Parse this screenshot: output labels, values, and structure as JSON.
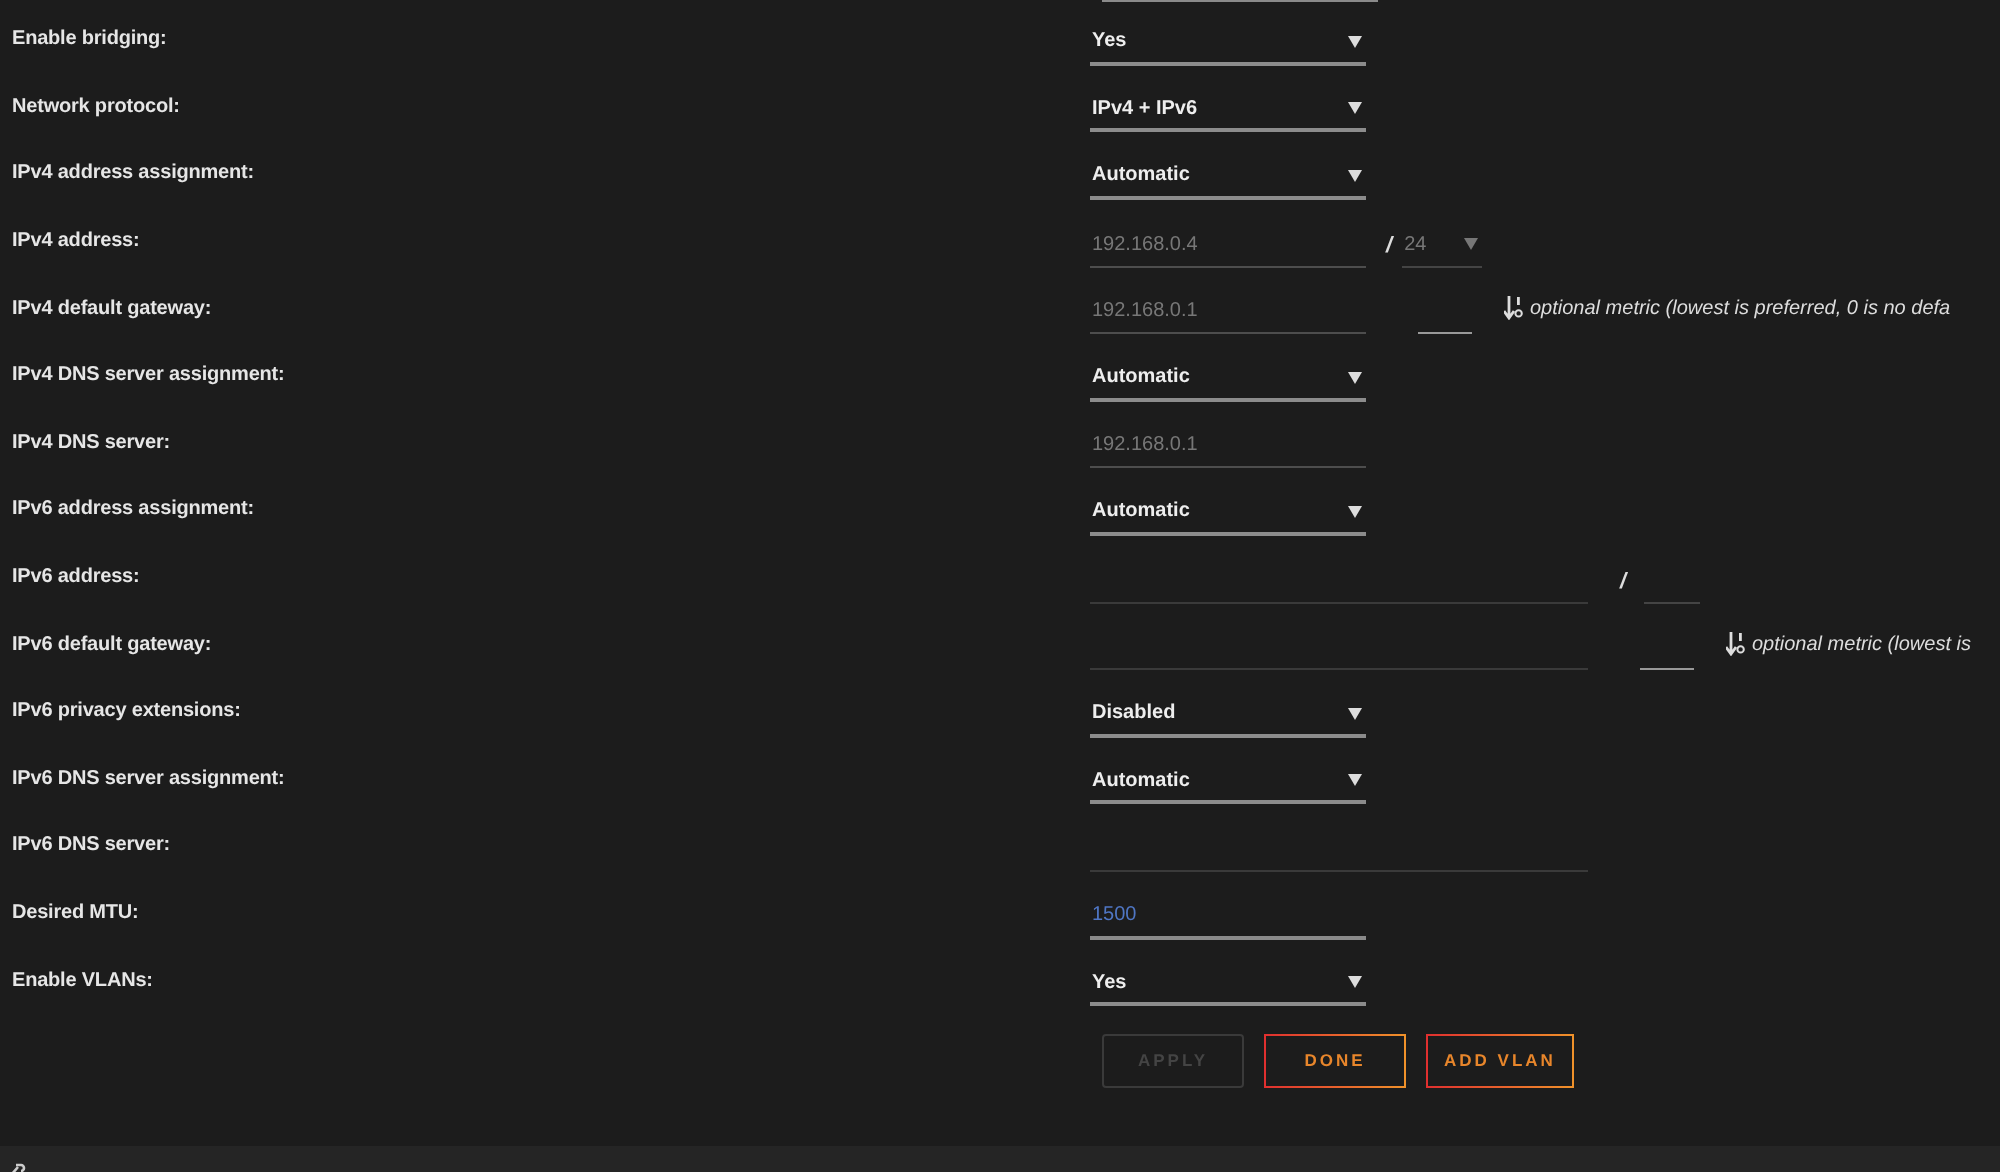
{
  "rows": [
    {
      "label": "Enable bridging:",
      "kind": "select",
      "value": "Yes",
      "disabled": false
    },
    {
      "label": "Network protocol:",
      "kind": "select",
      "value": "IPv4 + IPv6",
      "disabled": false
    },
    {
      "label": "IPv4 address assignment:",
      "kind": "select",
      "value": "Automatic",
      "disabled": false
    },
    {
      "label": "IPv4 address:",
      "kind": "input",
      "value": "192.168.0.4",
      "disabled": true,
      "prefix": {
        "separator": "/",
        "kind": "select",
        "value": "24",
        "disabled": true
      }
    },
    {
      "label": "IPv4 default gateway:",
      "kind": "input",
      "value": "192.168.0.1",
      "disabled": true,
      "metric": {
        "hint": "optional metric (lowest is preferred, 0 is no defa"
      }
    },
    {
      "label": "IPv4 DNS server assignment:",
      "kind": "select",
      "value": "Automatic",
      "disabled": false
    },
    {
      "label": "IPv4 DNS server:",
      "kind": "input",
      "value": "192.168.0.1",
      "disabled": true
    },
    {
      "label": "IPv6 address assignment:",
      "kind": "select",
      "value": "Automatic",
      "disabled": false
    },
    {
      "label": "IPv6 address:",
      "kind": "wide-input",
      "disabled": true,
      "prefix": {
        "separator": "/",
        "kind": "input",
        "disabled": true
      }
    },
    {
      "label": "IPv6 default gateway:",
      "kind": "wide-input",
      "disabled": true,
      "metric": {
        "hint": "optional metric (lowest is"
      }
    },
    {
      "label": "IPv6 privacy extensions:",
      "kind": "select",
      "value": "Disabled",
      "disabled": false
    },
    {
      "label": "IPv6 DNS server assignment:",
      "kind": "select",
      "value": "Automatic",
      "disabled": false
    },
    {
      "label": "IPv6 DNS server:",
      "kind": "wide-input",
      "disabled": true
    },
    {
      "label": "Desired MTU:",
      "kind": "input",
      "value": "1500",
      "disabled": false
    },
    {
      "label": "Enable VLANs:",
      "kind": "select",
      "value": "Yes",
      "disabled": false
    }
  ],
  "buttons": [
    {
      "label": "APPLY",
      "disabled": true
    },
    {
      "label": "DONE",
      "disabled": false
    },
    {
      "label": "ADD VLAN",
      "disabled": false
    }
  ]
}
